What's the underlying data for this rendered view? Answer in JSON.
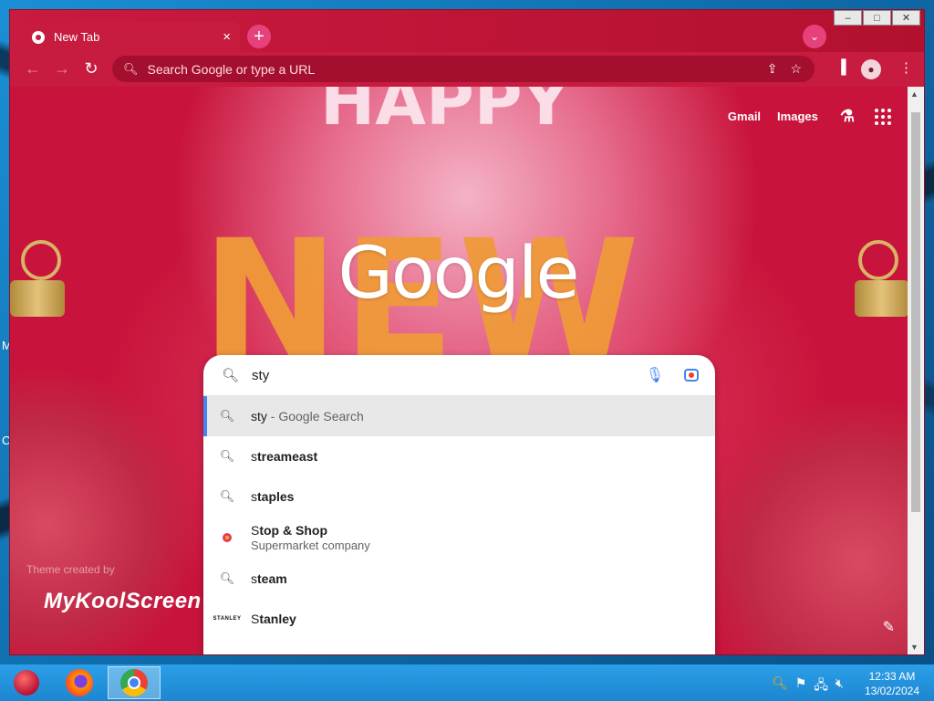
{
  "browser": {
    "tab_title": "New Tab",
    "omnibox_placeholder": "Search Google or type a URL",
    "window_controls": [
      "–",
      "□",
      "✕"
    ]
  },
  "ntp": {
    "links": [
      "Gmail",
      "Images"
    ],
    "logo_text": "Google",
    "theme_credit": "Theme created by",
    "theme_brand": "MyKoolScreen",
    "decor_top": "HAPPY",
    "decor_mid": "NEW"
  },
  "search": {
    "query": "sty",
    "suggestions": [
      {
        "prefix": "sty",
        "rest": " - Google Search",
        "type": "search",
        "selected": true
      },
      {
        "prefix": "s",
        "rest": "treameast",
        "type": "search"
      },
      {
        "prefix": "s",
        "rest": "taples",
        "type": "search"
      },
      {
        "prefix": "S",
        "rest": "top & Shop",
        "sub": "Supermarket company",
        "type": "entity",
        "logo": "Stop&Shop"
      },
      {
        "prefix": "s",
        "rest": "team",
        "type": "search"
      },
      {
        "prefix": "S",
        "rest": "tanley",
        "type": "entity",
        "logo": "STANLEY"
      }
    ]
  },
  "desktop": {
    "left_letters": [
      "M",
      "C"
    ]
  },
  "taskbar": {
    "time": "12:33 AM",
    "date": "13/02/2024"
  },
  "colors": {
    "chrome_frame": "#c71b40",
    "omnibox": "#a40f2f",
    "accent_blue": "#4285f4"
  }
}
